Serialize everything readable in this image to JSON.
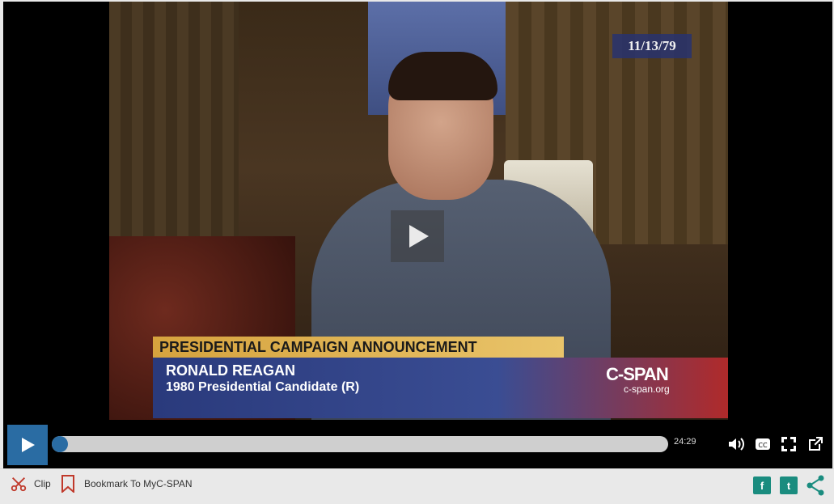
{
  "video": {
    "date_stamp": "11/13/79",
    "banner_title": "PRESIDENTIAL CAMPAIGN ANNOUNCEMENT",
    "person_name": "RONALD REAGAN",
    "person_role": "1980 Presidential Candidate (R)",
    "logo": "C-SPAN",
    "logo_url": "c-span.org"
  },
  "player": {
    "duration": "24:29",
    "progress_fraction": 0.0,
    "accent_color": "#2a6ca3"
  },
  "toolbar": {
    "clip_label": "Clip",
    "bookmark_label": "Bookmark To MyC-SPAN",
    "share_accent_color": "#1a8c7f",
    "facebook_glyph": "f",
    "twitter_glyph": "t"
  }
}
